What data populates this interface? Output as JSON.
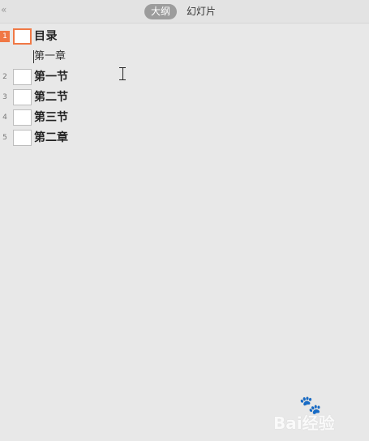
{
  "topbar": {
    "collapse_icon": "«",
    "tabs": [
      {
        "label": "大纲",
        "active": true
      },
      {
        "label": "幻灯片",
        "active": false
      }
    ]
  },
  "outline": {
    "slides": [
      {
        "number": "1",
        "title": "目录",
        "sub": "第一章",
        "active": true
      },
      {
        "number": "2",
        "title": "第一节",
        "active": false
      },
      {
        "number": "3",
        "title": "第二节",
        "active": false
      },
      {
        "number": "4",
        "title": "第三节",
        "active": false
      },
      {
        "number": "5",
        "title": "第二章",
        "active": false
      }
    ]
  },
  "watermark": {
    "text": "Bai经验",
    "paw_icon": "paw-icon"
  },
  "colors": {
    "accent": "#f07845",
    "background": "#e8e8e8",
    "tab_active": "#9c9c9c"
  }
}
